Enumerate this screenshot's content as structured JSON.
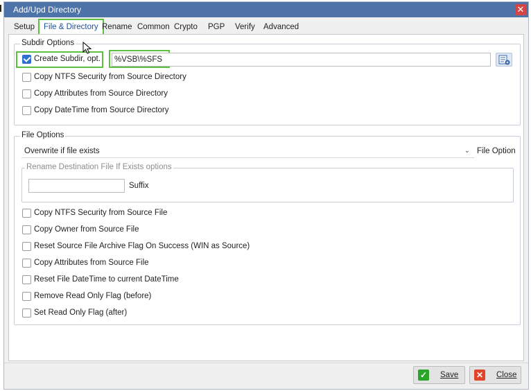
{
  "window": {
    "title": "Add/Upd Directory",
    "close_glyph": "✕"
  },
  "tabs": [
    {
      "label": "Setup"
    },
    {
      "label": "File & Directory"
    },
    {
      "label": "Rename"
    },
    {
      "label": "Common"
    },
    {
      "label": "Crypto"
    },
    {
      "label": "PGP"
    },
    {
      "label": "Verify"
    },
    {
      "label": "Advanced"
    }
  ],
  "active_tab": "File & Directory",
  "subdir_options": {
    "title": "Subdir Options",
    "create_subdir": {
      "label": "Create Subdir, opt.",
      "checked": true
    },
    "subdir_value": "%VSB\\%SFS",
    "picker_icon": "macro-list-icon",
    "checkboxes": [
      {
        "label": "Copy NTFS Security from Source Directory",
        "checked": false
      },
      {
        "label": "Copy Attributes from Source Directory",
        "checked": false
      },
      {
        "label": "Copy DateTime from Source Directory",
        "checked": false
      }
    ]
  },
  "file_options": {
    "title": "File Options",
    "file_option_value": "Overwrite if file exists",
    "file_option_label": "File Option",
    "rename_group": {
      "title": "Rename Destination File If Exists options",
      "suffix_value": "",
      "suffix_label": "Suffix"
    },
    "checkboxes": [
      {
        "label": "Copy NTFS Security from Source File",
        "checked": false
      },
      {
        "label": "Copy Owner from Source File",
        "checked": false
      },
      {
        "label": "Reset Source File Archive Flag On Success (WIN as Source)",
        "checked": false
      },
      {
        "label": "Copy Attributes from Source File",
        "checked": false
      },
      {
        "label": "Reset File DateTime to current DateTime",
        "checked": false
      },
      {
        "label": "Remove Read Only Flag (before)",
        "checked": false
      },
      {
        "label": "Set Read Only Flag (after)",
        "checked": false
      }
    ]
  },
  "buttons": {
    "save": {
      "label": "Save",
      "icon": "check-icon",
      "color": "#2aa52a"
    },
    "close": {
      "label": "Close",
      "icon": "x-icon",
      "color": "#e0452b"
    }
  },
  "colors": {
    "titlebar": "#4d73a8",
    "highlight": "#5cc03f",
    "checkbox_checked": "#2f6fd0"
  }
}
